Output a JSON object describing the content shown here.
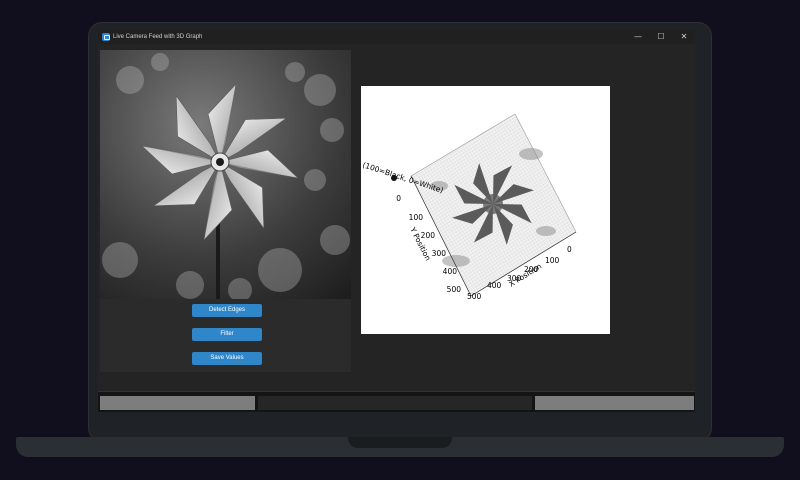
{
  "window": {
    "title": "Live Camera Feed with 3D Graph",
    "controls": {
      "minimize": "—",
      "maximize": "☐",
      "close": "✕"
    },
    "accent_color": "#2f86c9"
  },
  "camera": {
    "image": "grayscale pinwheel photo",
    "icon": "camera-feed-image"
  },
  "buttons": {
    "detect_edges": "Detect Edges",
    "filter": "Filter",
    "save_values": "Save Values"
  },
  "graph": {
    "x_label": "X Position",
    "y_label": "Y Position",
    "x_ticks": [
      "0",
      "100",
      "200",
      "300",
      "400",
      "500"
    ],
    "y_ticks": [
      "0",
      "100",
      "200",
      "300",
      "400",
      "500"
    ],
    "z_label": "(100=Black, 0=White)"
  }
}
